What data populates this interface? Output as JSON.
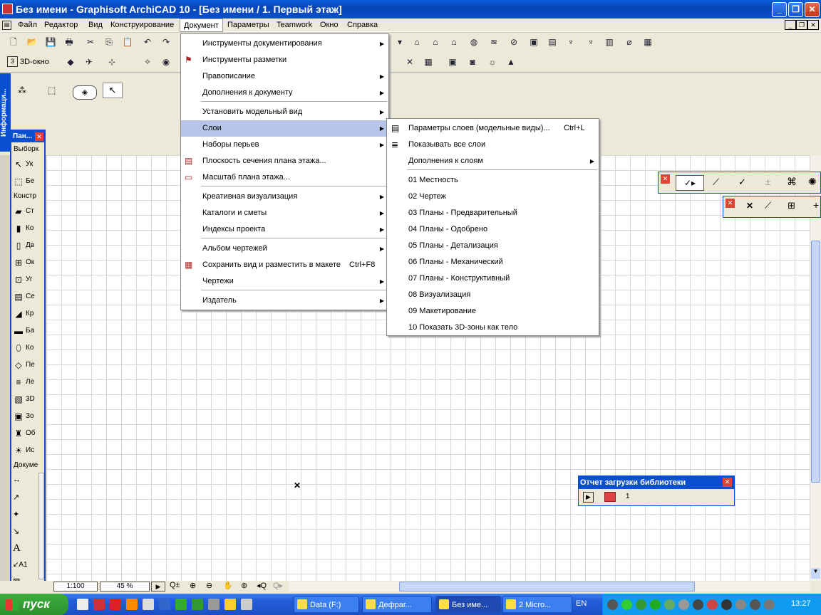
{
  "window": {
    "title": "Без имени - Graphisoft ArchiCAD 10 - [Без имени / 1. Первый этаж]"
  },
  "menubar": [
    {
      "label": "Файл",
      "active": false
    },
    {
      "label": "Редактор",
      "active": false
    },
    {
      "label": "Вид",
      "active": false
    },
    {
      "label": "Конструирование",
      "active": false
    },
    {
      "label": "Документ",
      "active": true
    },
    {
      "label": "Параметры",
      "active": false
    },
    {
      "label": "Teamwork",
      "active": false
    },
    {
      "label": "Окно",
      "active": false
    },
    {
      "label": "Справка",
      "active": false
    }
  ],
  "toolbar": {
    "view3d": "3D-окно"
  },
  "info_panel": {
    "title": "Информаци..."
  },
  "toolbox": {
    "title": "Пан...",
    "section_select": "Выборк",
    "select_items": [
      "Ук",
      "Бе"
    ],
    "section_construct": "Констр",
    "construct_items": [
      "Ст",
      "Ко",
      "Дв",
      "Ок",
      "Уг",
      "Се",
      "Кр",
      "Ба",
      "Ко",
      "Пе",
      "Ле",
      "3D",
      "Зо",
      "Об",
      "Ис"
    ],
    "section_doc": "Докуме"
  },
  "document_menu": {
    "items": [
      {
        "label": "Инструменты документирования",
        "submenu": true,
        "selected": false
      },
      {
        "label": "Инструменты разметки",
        "submenu": false,
        "selected": false
      },
      {
        "label": "Правописание",
        "submenu": true,
        "selected": false
      },
      {
        "label": "Дополнения к документу",
        "submenu": true,
        "selected": false
      },
      {
        "label": "Установить модельный вид",
        "submenu": true,
        "selected": false
      },
      {
        "label": "Слои",
        "submenu": true,
        "selected": true
      },
      {
        "label": "Наборы перьев",
        "submenu": true,
        "selected": false
      },
      {
        "label": "Плоскость сечения плана этажа...",
        "submenu": false,
        "selected": false
      },
      {
        "label": "Масштаб плана этажа...",
        "submenu": false,
        "selected": false
      },
      {
        "label": "Креативная визуализация",
        "submenu": true,
        "selected": false
      },
      {
        "label": "Каталоги и сметы",
        "submenu": true,
        "selected": false
      },
      {
        "label": "Индексы проекта",
        "submenu": true,
        "selected": false
      },
      {
        "label": "Альбом чертежей",
        "submenu": true,
        "selected": false
      },
      {
        "label": "Сохранить вид и разместить в макете",
        "shortcut": "Ctrl+F8",
        "submenu": false,
        "selected": false
      },
      {
        "label": "Чертежи",
        "submenu": true,
        "selected": false
      },
      {
        "label": "Издатель",
        "submenu": true,
        "selected": false
      }
    ]
  },
  "layers_submenu": {
    "items": [
      {
        "label": "Параметры слоев (модельные виды)...",
        "shortcut": "Ctrl+L"
      },
      {
        "label": "Показывать все слои",
        "shortcut": ""
      },
      {
        "label": "Дополнения к слоям",
        "shortcut": "",
        "submenu": true
      },
      {
        "label": "01 Местность"
      },
      {
        "label": "02 Чертеж"
      },
      {
        "label": "03 Планы - Предварительный"
      },
      {
        "label": "04 Планы - Одобрено"
      },
      {
        "label": "05 Планы - Детализация"
      },
      {
        "label": "06 Планы - Механический"
      },
      {
        "label": "07 Планы - Конструктивный"
      },
      {
        "label": "08 Визуализация"
      },
      {
        "label": "09 Макетирование"
      },
      {
        "label": "10 Показать 3D-зоны как тело"
      }
    ]
  },
  "library_report": {
    "title": "Отчет загрузки библиотеки",
    "count": "1"
  },
  "statusbar": {
    "scale": "1:100",
    "zoom": "45 %"
  },
  "taskbar": {
    "start": "пуск",
    "tasks": [
      "Data (F:)",
      "Дефраг...",
      "Без име...",
      "2 Micro..."
    ],
    "lang": "EN",
    "time": "13:27"
  }
}
